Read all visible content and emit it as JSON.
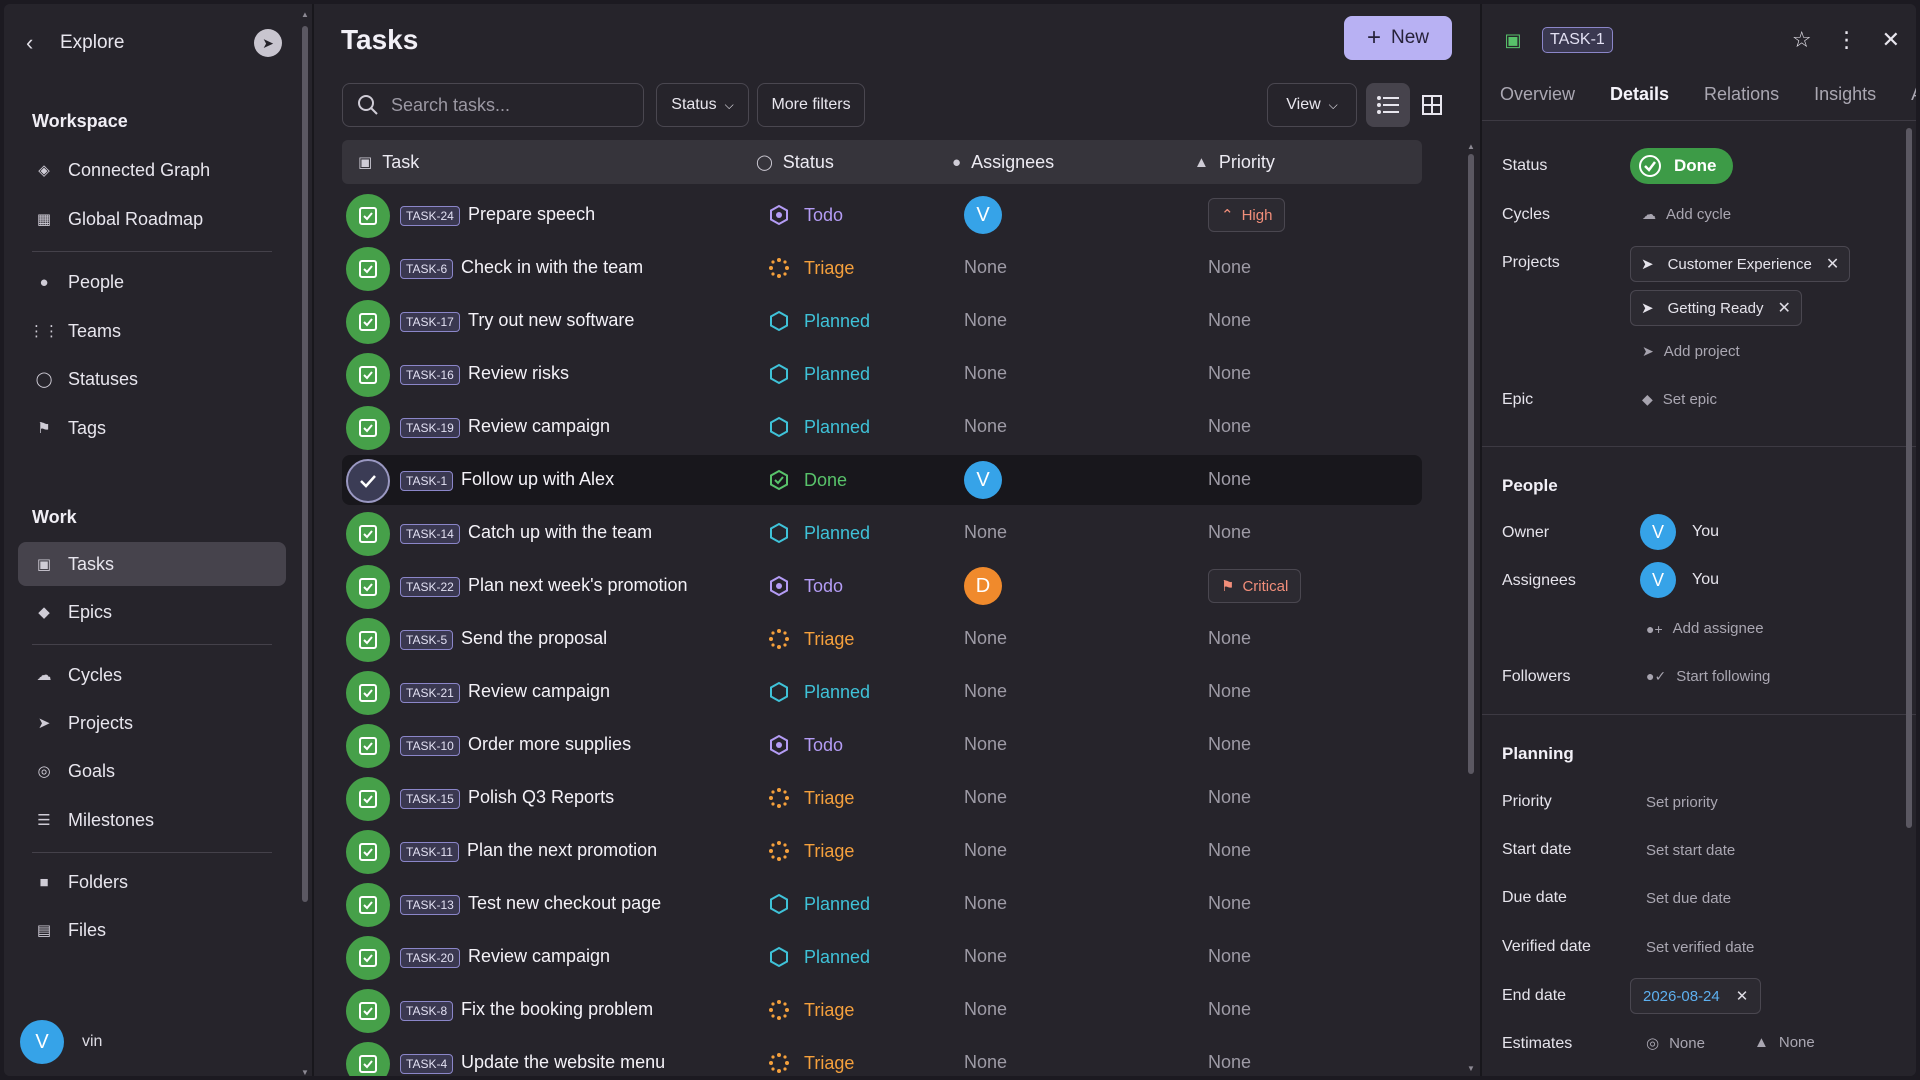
{
  "sidebar": {
    "header": {
      "title": "Explore"
    },
    "workspace_label": "Workspace",
    "work_label": "Work",
    "items": [
      {
        "label": "Connected Graph",
        "icon": "graph-icon"
      },
      {
        "label": "Global Roadmap",
        "icon": "map-icon"
      },
      {
        "label": "People",
        "icon": "people-icon"
      },
      {
        "label": "Teams",
        "icon": "teams-icon"
      },
      {
        "label": "Statuses",
        "icon": "status-icon"
      },
      {
        "label": "Tags",
        "icon": "tag-icon"
      },
      {
        "label": "Tasks",
        "icon": "task-icon",
        "active": true
      },
      {
        "label": "Epics",
        "icon": "gem-icon"
      },
      {
        "label": "Cycles",
        "icon": "cloud-icon"
      },
      {
        "label": "Projects",
        "icon": "rocket-icon"
      },
      {
        "label": "Goals",
        "icon": "target-icon"
      },
      {
        "label": "Milestones",
        "icon": "milestone-icon"
      },
      {
        "label": "Folders",
        "icon": "folder-icon"
      },
      {
        "label": "Files",
        "icon": "file-icon"
      }
    ],
    "user": {
      "initial": "V",
      "name": "vin"
    }
  },
  "main": {
    "title": "Tasks",
    "new_label": "New",
    "search_placeholder": "Search tasks...",
    "status_filter": "Status",
    "more_filters": "More filters",
    "view_label": "View",
    "columns": {
      "task": "Task",
      "status": "Status",
      "assignees": "Assignees",
      "priority": "Priority"
    },
    "rows": [
      {
        "id": "TASK-24",
        "name": "Prepare speech",
        "status": "Todo",
        "assignee": "V",
        "priority": "High"
      },
      {
        "id": "TASK-6",
        "name": "Check in with the team",
        "status": "Triage",
        "assignee": "None",
        "priority": "None"
      },
      {
        "id": "TASK-17",
        "name": "Try out new software",
        "status": "Planned",
        "assignee": "None",
        "priority": "None"
      },
      {
        "id": "TASK-16",
        "name": "Review risks",
        "status": "Planned",
        "assignee": "None",
        "priority": "None"
      },
      {
        "id": "TASK-19",
        "name": "Review campaign",
        "status": "Planned",
        "assignee": "None",
        "priority": "None"
      },
      {
        "id": "TASK-1",
        "name": "Follow up with Alex",
        "status": "Done",
        "assignee": "V",
        "priority": "None",
        "selected": true
      },
      {
        "id": "TASK-14",
        "name": "Catch up with the team",
        "status": "Planned",
        "assignee": "None",
        "priority": "None"
      },
      {
        "id": "TASK-22",
        "name": "Plan next week's promotion",
        "status": "Todo",
        "assignee": "D",
        "priority": "Critical"
      },
      {
        "id": "TASK-5",
        "name": "Send the proposal",
        "status": "Triage",
        "assignee": "None",
        "priority": "None"
      },
      {
        "id": "TASK-21",
        "name": "Review campaign",
        "status": "Planned",
        "assignee": "None",
        "priority": "None"
      },
      {
        "id": "TASK-10",
        "name": "Order more supplies",
        "status": "Todo",
        "assignee": "None",
        "priority": "None"
      },
      {
        "id": "TASK-15",
        "name": "Polish Q3 Reports",
        "status": "Triage",
        "assignee": "None",
        "priority": "None"
      },
      {
        "id": "TASK-11",
        "name": "Plan the next promotion",
        "status": "Triage",
        "assignee": "None",
        "priority": "None"
      },
      {
        "id": "TASK-13",
        "name": "Test new checkout page",
        "status": "Planned",
        "assignee": "None",
        "priority": "None"
      },
      {
        "id": "TASK-20",
        "name": "Review campaign",
        "status": "Planned",
        "assignee": "None",
        "priority": "None"
      },
      {
        "id": "TASK-8",
        "name": "Fix the booking problem",
        "status": "Triage",
        "assignee": "None",
        "priority": "None"
      },
      {
        "id": "TASK-4",
        "name": "Update the website menu",
        "status": "Triage",
        "assignee": "None",
        "priority": "None"
      }
    ]
  },
  "panel": {
    "task_id": "TASK-1",
    "tabs": [
      "Overview",
      "Details",
      "Relations",
      "Insights",
      "A"
    ],
    "active_tab": "Details",
    "status_label": "Status",
    "status_value": "Done",
    "cycles_label": "Cycles",
    "add_cycle": "Add cycle",
    "projects_label": "Projects",
    "projects": [
      "Customer Experience",
      "Getting Ready"
    ],
    "add_project": "Add project",
    "epic_label": "Epic",
    "set_epic": "Set epic",
    "people_section": "People",
    "owner_label": "Owner",
    "owner_initial": "V",
    "owner_name": "You",
    "assignees_label": "Assignees",
    "assignee_initial": "V",
    "assignee_name": "You",
    "add_assignee": "Add assignee",
    "followers_label": "Followers",
    "start_following": "Start following",
    "planning_section": "Planning",
    "priority_label": "Priority",
    "set_priority": "Set priority",
    "start_date_label": "Start date",
    "set_start_date": "Set start date",
    "due_date_label": "Due date",
    "set_due_date": "Set due date",
    "verified_date_label": "Verified date",
    "set_verified_date": "Set verified date",
    "end_date_label": "End date",
    "end_date_value": "2026-08-24",
    "estimates_label": "Estimates",
    "estimate_points": "None",
    "estimate_time": "None"
  },
  "colors": {
    "accent": "#b8b1f3",
    "done": "#3d9b47",
    "todo": "#b49cf5",
    "triage": "#f5a03c",
    "planned": "#3fc2d8",
    "avatar_blue": "#36a3e8",
    "avatar_orange": "#f08a2c"
  }
}
